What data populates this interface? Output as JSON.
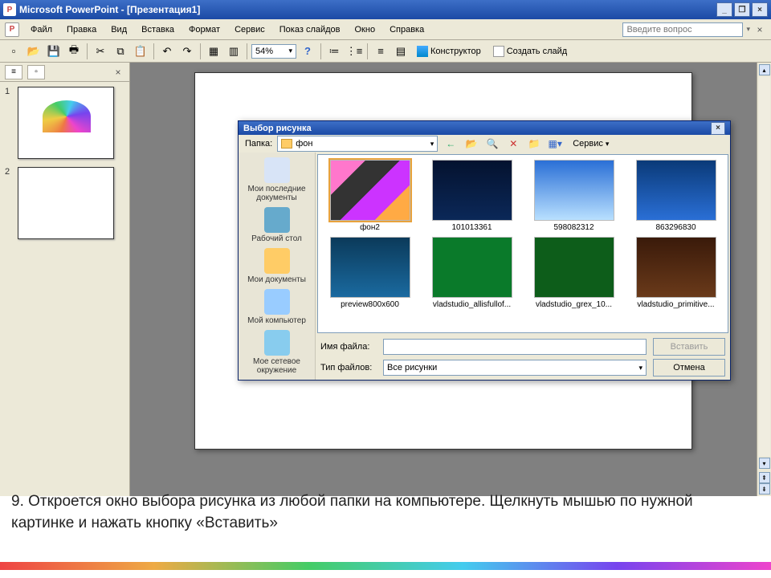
{
  "title": "Microsoft PowerPoint - [Презентация1]",
  "menu": [
    "Файл",
    "Правка",
    "Вид",
    "Вставка",
    "Формат",
    "Сервис",
    "Показ слайдов",
    "Окно",
    "Справка"
  ],
  "ask_placeholder": "Введите вопрос",
  "zoom": "54%",
  "designer": "Конструктор",
  "newslide": "Создать слайд",
  "slides": [
    "1",
    "2"
  ],
  "dialog": {
    "title": "Выбор рисунка",
    "folder_label": "Папка:",
    "folder_value": "фон",
    "service": "Сервис",
    "places": [
      {
        "label": "Мои последние документы"
      },
      {
        "label": "Рабочий стол"
      },
      {
        "label": "Мои документы"
      },
      {
        "label": "Мой компьютер"
      },
      {
        "label": "Мое сетевое окружение"
      }
    ],
    "files": [
      {
        "name": "фон2",
        "sel": true,
        "bg": "linear-gradient(135deg,#f7c 0 25%,#333 25% 50%,#c3f 50% 75%,#fa4 75%)"
      },
      {
        "name": "101013361",
        "bg": "linear-gradient(#04122f,#0b2858)"
      },
      {
        "name": "598082312",
        "bg": "linear-gradient(#2a6fd6,#b9e0ff)"
      },
      {
        "name": "863296830",
        "bg": "linear-gradient(#0a3a78,#2a6fd6)"
      },
      {
        "name": "preview800x600",
        "bg": "linear-gradient(#0b3a5a,#1a6aa0)"
      },
      {
        "name": "vladstudio_allisfullof...",
        "bg": "#0a7a2a"
      },
      {
        "name": "vladstudio_grex_10...",
        "bg": "#0d5d1a"
      },
      {
        "name": "vladstudio_primitive...",
        "bg": "linear-gradient(#3a1a0a,#6a3a1a)"
      }
    ],
    "filename_label": "Имя файла:",
    "filetype_label": "Тип файлов:",
    "filetype_value": "Все рисунки",
    "insert": "Вставить",
    "cancel": "Отмена"
  },
  "caption": "9.   Откроется окно выбора рисунка из любой папки на компьютере. Щелкнуть мышью по нужной картинке и нажать кнопку «Вставить»"
}
